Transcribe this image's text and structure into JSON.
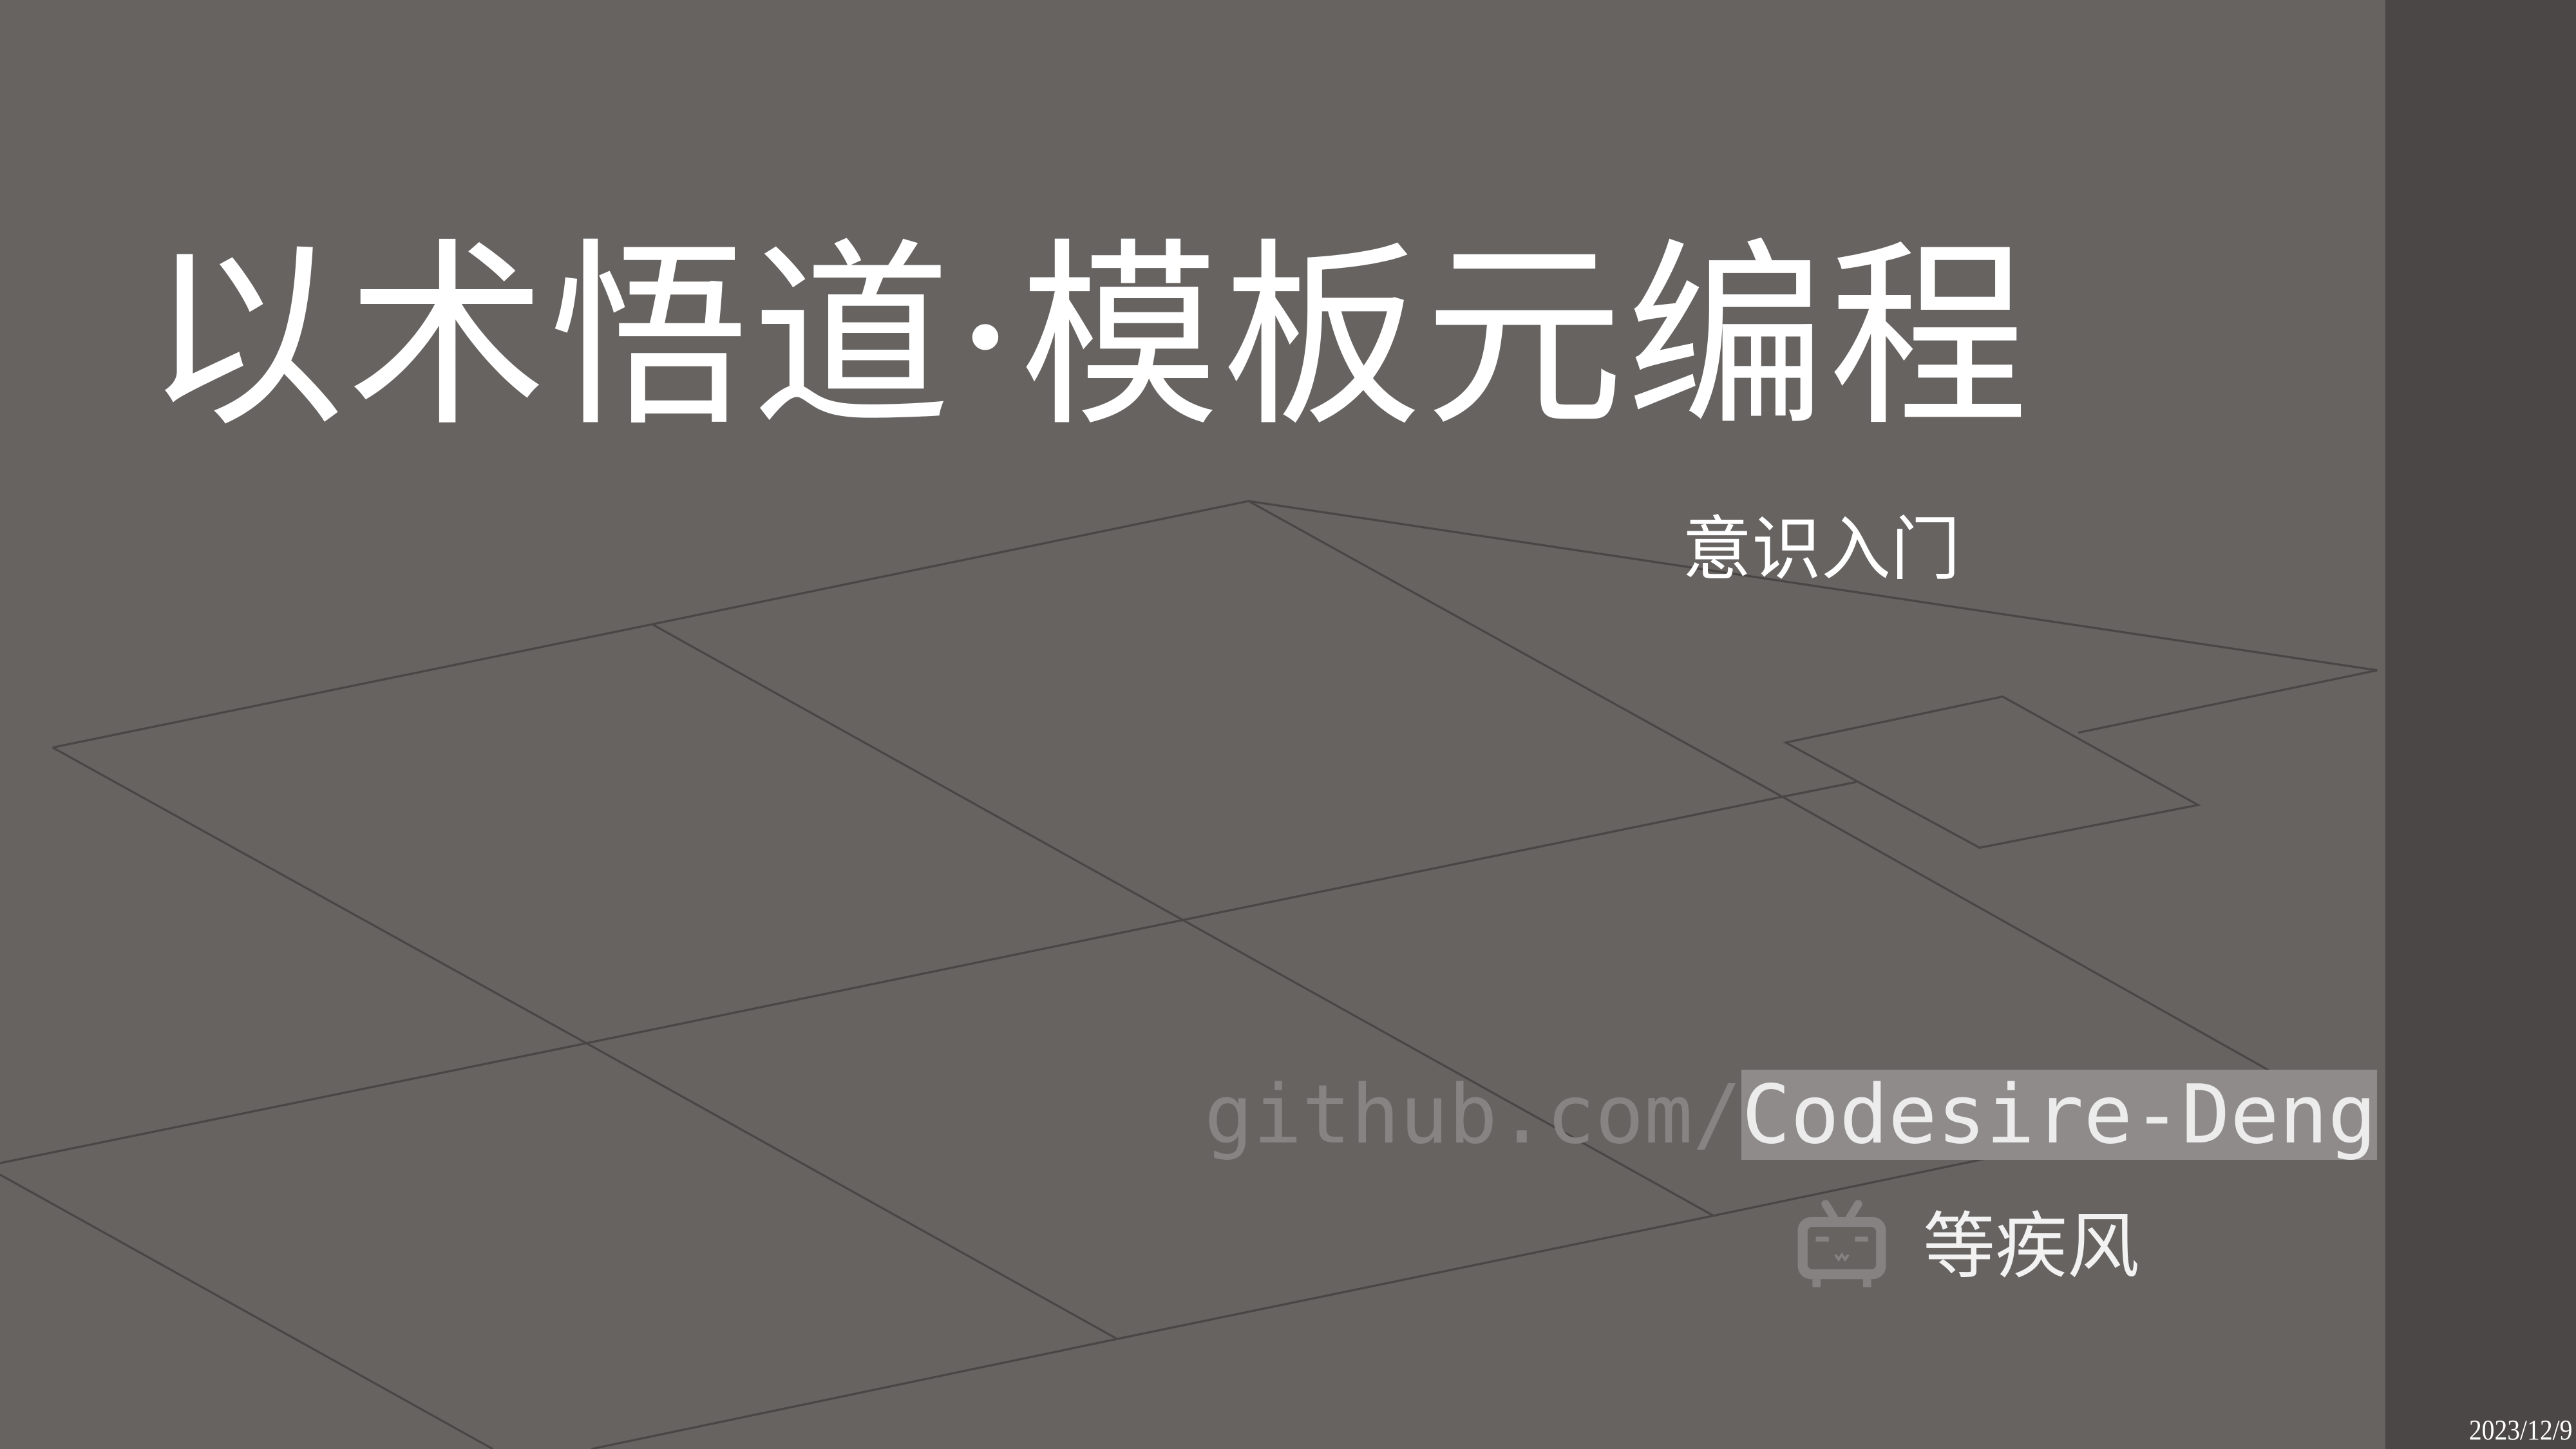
{
  "slide": {
    "title": "以术悟道·模板元编程",
    "subtitle": "意识入门",
    "github_prefix": "github.com/",
    "github_user": "Codesire-Deng",
    "author_icon": "bilibili-tv-icon",
    "author": "等疾风",
    "date": "2023/12/9"
  },
  "colors": {
    "background": "#676361",
    "sidebar": "#4b4747",
    "grid_line": "#4a4645",
    "highlight": "#8f8b8a"
  }
}
